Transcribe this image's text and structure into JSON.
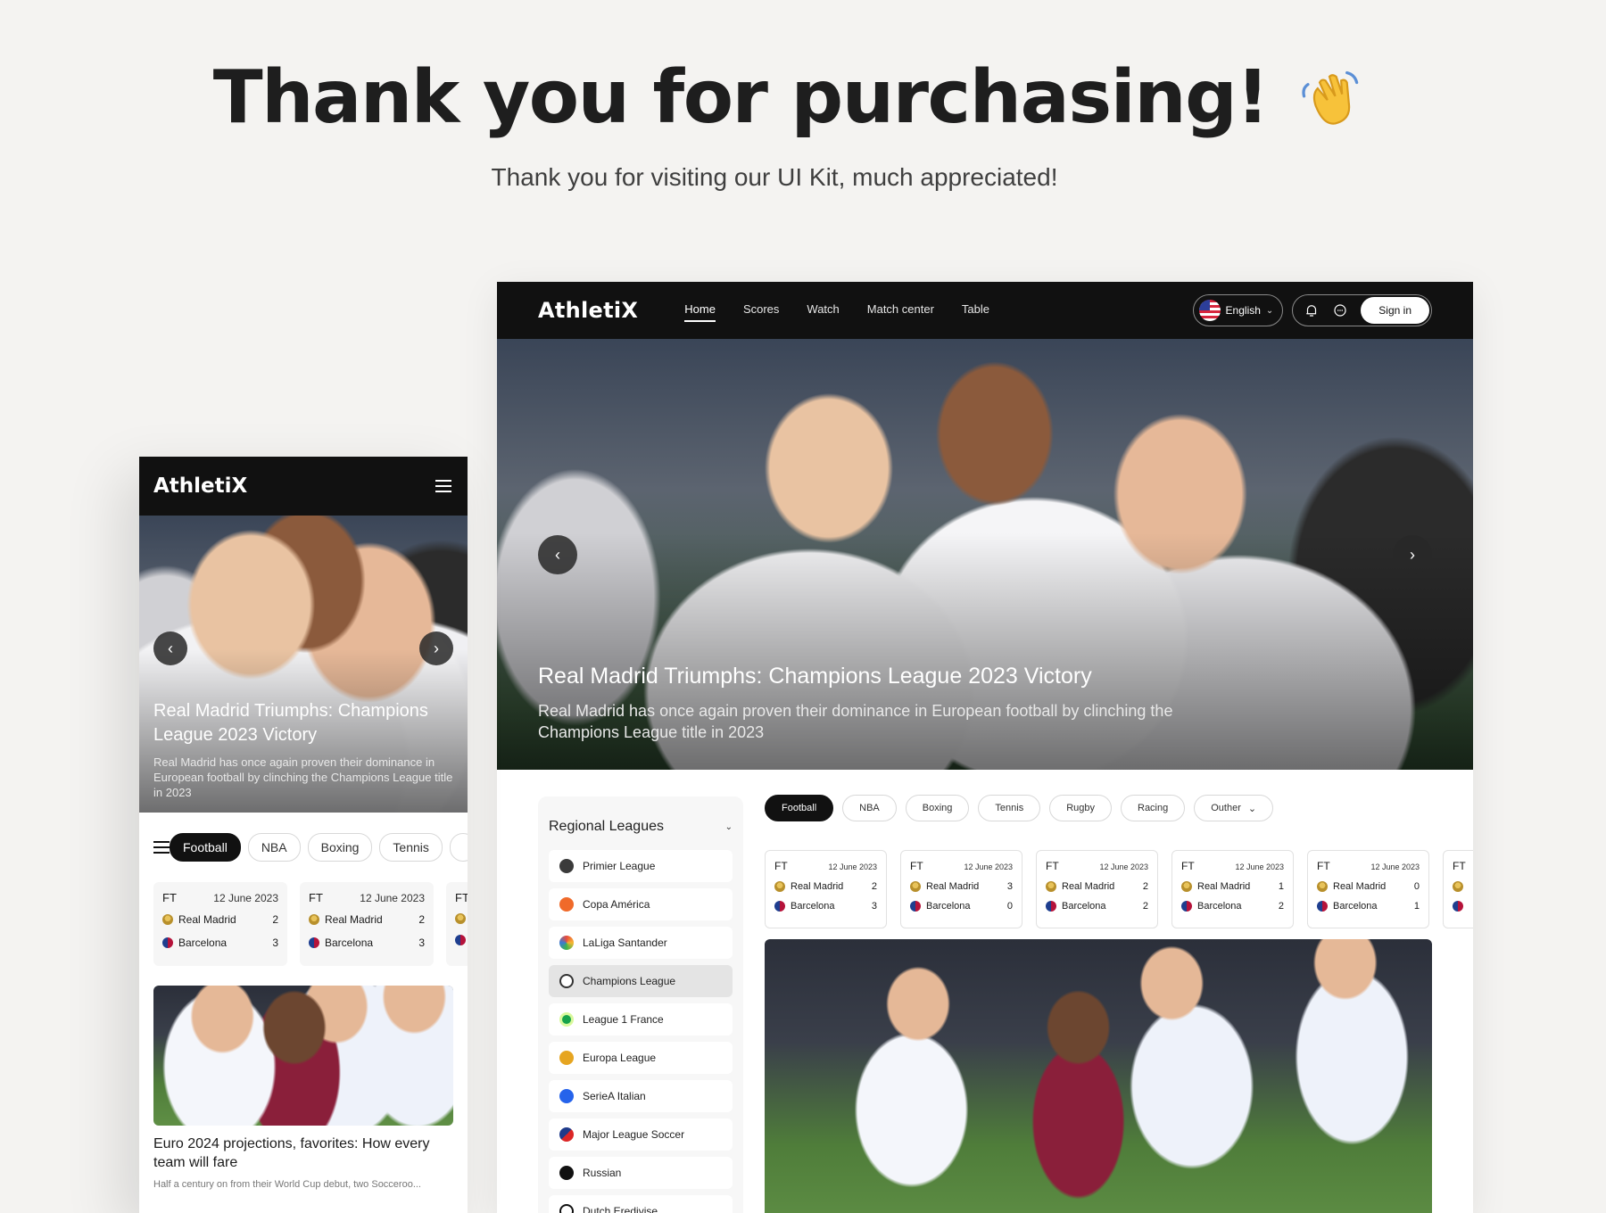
{
  "page": {
    "title": "Thank you for purchasing!",
    "subtitle": "Thank you for visiting our UI Kit, much appreciated!"
  },
  "desktop": {
    "logo": "AthletiX",
    "nav": [
      "Home",
      "Scores",
      "Watch",
      "Match center",
      "Table"
    ],
    "language": "English",
    "sign_in": "Sign in",
    "hero": {
      "title": "Real Madrid Triumphs: Champions League 2023 Victory",
      "text": "Real Madrid has once again proven their dominance in European football by clinching the Champions League title in 2023"
    },
    "sidebar": {
      "heading": "Regional Leagues",
      "leagues": [
        "Primier League",
        "Copa América",
        "LaLiga Santander",
        "Champions League",
        "League 1 France",
        "Europa League",
        "SerieA Italian",
        "Major League Soccer",
        "Russian",
        "Dutch Eredivise"
      ],
      "active": "Champions League"
    },
    "tabs": [
      "Football",
      "NBA",
      "Boxing",
      "Tennis",
      "Rugby",
      "Racing",
      "Outher"
    ],
    "scores": [
      {
        "status": "FT",
        "date": "12 June 2023",
        "home": "Real Madrid",
        "home_score": "2",
        "away": "Barcelona",
        "away_score": "3"
      },
      {
        "status": "FT",
        "date": "12 June 2023",
        "home": "Real Madrid",
        "home_score": "3",
        "away": "Barcelona",
        "away_score": "0"
      },
      {
        "status": "FT",
        "date": "12 June 2023",
        "home": "Real Madrid",
        "home_score": "2",
        "away": "Barcelona",
        "away_score": "2"
      },
      {
        "status": "FT",
        "date": "12 June 2023",
        "home": "Real Madrid",
        "home_score": "1",
        "away": "Barcelona",
        "away_score": "2"
      },
      {
        "status": "FT",
        "date": "12 June 2023",
        "home": "Real Madrid",
        "home_score": "0",
        "away": "Barcelona",
        "away_score": "1"
      },
      {
        "status": "FT",
        "date": "",
        "home": "",
        "home_score": "",
        "away": "",
        "away_score": ""
      }
    ]
  },
  "mobile": {
    "logo": "AthletiX",
    "hero": {
      "title": "Real Madrid Triumphs: Champions League 2023 Victory",
      "text": "Real Madrid has once again proven their dominance in European football by clinching the Champions League title in 2023"
    },
    "tabs": [
      "Football",
      "NBA",
      "Boxing",
      "Tennis"
    ],
    "scores": [
      {
        "status": "FT",
        "date": "12 June 2023",
        "home": "Real Madrid",
        "home_score": "2",
        "away": "Barcelona",
        "away_score": "3"
      },
      {
        "status": "FT",
        "date": "12 June 2023",
        "home": "Real Madrid",
        "home_score": "2",
        "away": "Barcelona",
        "away_score": "3"
      },
      {
        "status": "FT",
        "date": "",
        "home": "",
        "home_score": "",
        "away": "",
        "away_score": ""
      }
    ],
    "news": {
      "title": "Euro 2024 projections, favorites: How every team will fare",
      "excerpt": "Half a century on from their World Cup debut, two Socceroo..."
    }
  },
  "colors": {
    "dark": "#111111",
    "background": "#f4f3f1",
    "active_tab": "#111111"
  }
}
